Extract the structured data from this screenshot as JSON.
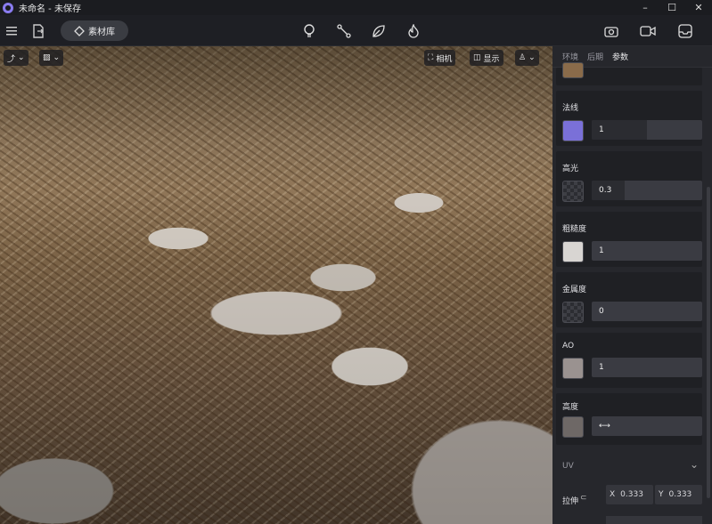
{
  "window": {
    "title": "未命名 - 未保存",
    "minimize": "–",
    "maximize": "☐",
    "close": "✕"
  },
  "toolbar": {
    "library_label": "素材库"
  },
  "viewport": {
    "camera_label": "相机",
    "display_label": "显示"
  },
  "panel": {
    "tabs": [
      "环境",
      "后期",
      "参数"
    ],
    "active_tab": "参数",
    "slots": [
      {
        "label": "法线",
        "value": "1",
        "fill": 0.5,
        "swatch": "#7a70d8"
      },
      {
        "label": "高光",
        "value": "0.3",
        "fill": 0.3
      },
      {
        "label": "粗糙度",
        "value": "1",
        "fill": 1,
        "swatch": "#d8d5d2"
      },
      {
        "label": "金属度",
        "value": "0",
        "fill": 0
      },
      {
        "label": "AO",
        "value": "1",
        "fill": 1
      },
      {
        "label": "高度",
        "value": "",
        "fill": 0
      }
    ],
    "uv": {
      "title": "UV",
      "stretch_label": "拉伸",
      "x_label": "X",
      "x_value": "0.333",
      "y_label": "Y",
      "y_value": "0.333"
    }
  }
}
